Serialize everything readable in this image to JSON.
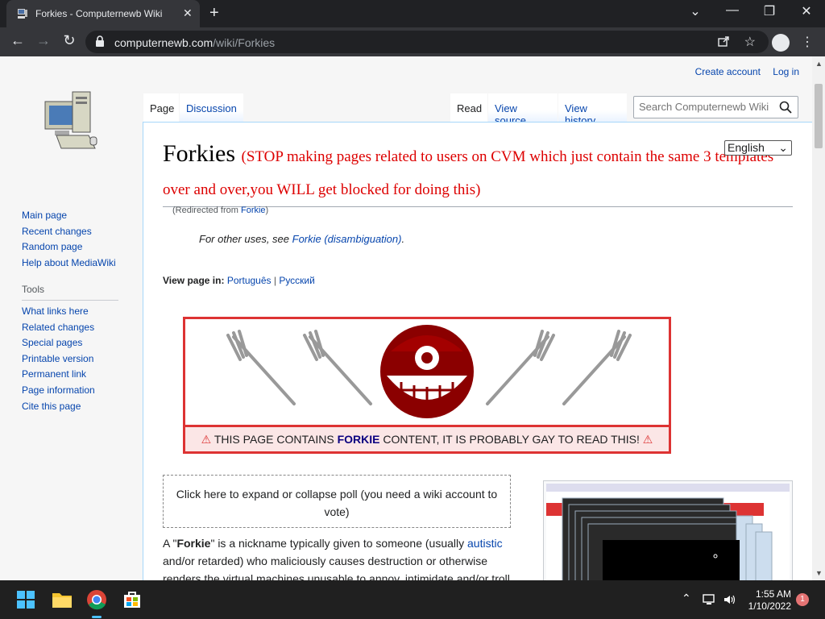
{
  "browser": {
    "tab_title": "Forkies - Computernewb Wiki",
    "tab_close": "✕",
    "new_tab": "+",
    "url_domain": "computernewb.com",
    "url_path": "/wiki/Forkies",
    "window_controls": {
      "list": "⌄",
      "minimize": "—",
      "restore": "❐",
      "close": "✕"
    }
  },
  "wiki": {
    "personal": {
      "create_account": "Create account",
      "log_in": "Log in"
    },
    "page_tabs": {
      "page": "Page",
      "discussion": "Discussion"
    },
    "view_tabs": {
      "read": "Read",
      "view_source": "View source",
      "view_history": "View history"
    },
    "search_placeholder": "Search Computernewb Wiki",
    "sidebar": {
      "nav": [
        "Main page",
        "Recent changes",
        "Random page",
        "Help about MediaWiki"
      ],
      "tools_heading": "Tools",
      "tools": [
        "What links here",
        "Related changes",
        "Special pages",
        "Printable version",
        "Permanent link",
        "Page information",
        "Cite this page"
      ]
    },
    "title": "Forkies",
    "title_warning": "(STOP making pages related to users on CVM which just contain the same 3 templates over and over,you WILL get blocked for doing this)",
    "language_select": "English",
    "redirect_prefix": "(Redirected from ",
    "redirect_link": "Forkie",
    "redirect_suffix": ")",
    "hatnote_prefix": "For other uses, see ",
    "hatnote_link": "Forkie (disambiguation)",
    "hatnote_suffix": ".",
    "view_in_label": "View page in:",
    "view_in_langs": [
      "Português",
      "Русский"
    ],
    "banner": {
      "before": "THIS PAGE CONTAINS ",
      "bold": "FORKIE",
      "after": " CONTENT, IT IS PROBABLY GAY TO READ THIS!"
    },
    "poll_text": "Click here to expand or collapse poll (you need a wiki account to vote)",
    "intro": {
      "a": "A \"",
      "bold": "Forkie",
      "b": "\" is a nickname typically given to someone (usually ",
      "link": "autistic",
      "c": " and/or retarded) who maliciously causes destruction or otherwise renders the virtual machines unusable to annoy, intimidate and/or troll"
    }
  },
  "taskbar": {
    "time": "1:55 AM",
    "date": "1/10/2022",
    "notification_count": "1"
  },
  "colors": {
    "accent_red": "#dd3333",
    "link": "#0645ad",
    "chrome_dark": "#202124"
  }
}
